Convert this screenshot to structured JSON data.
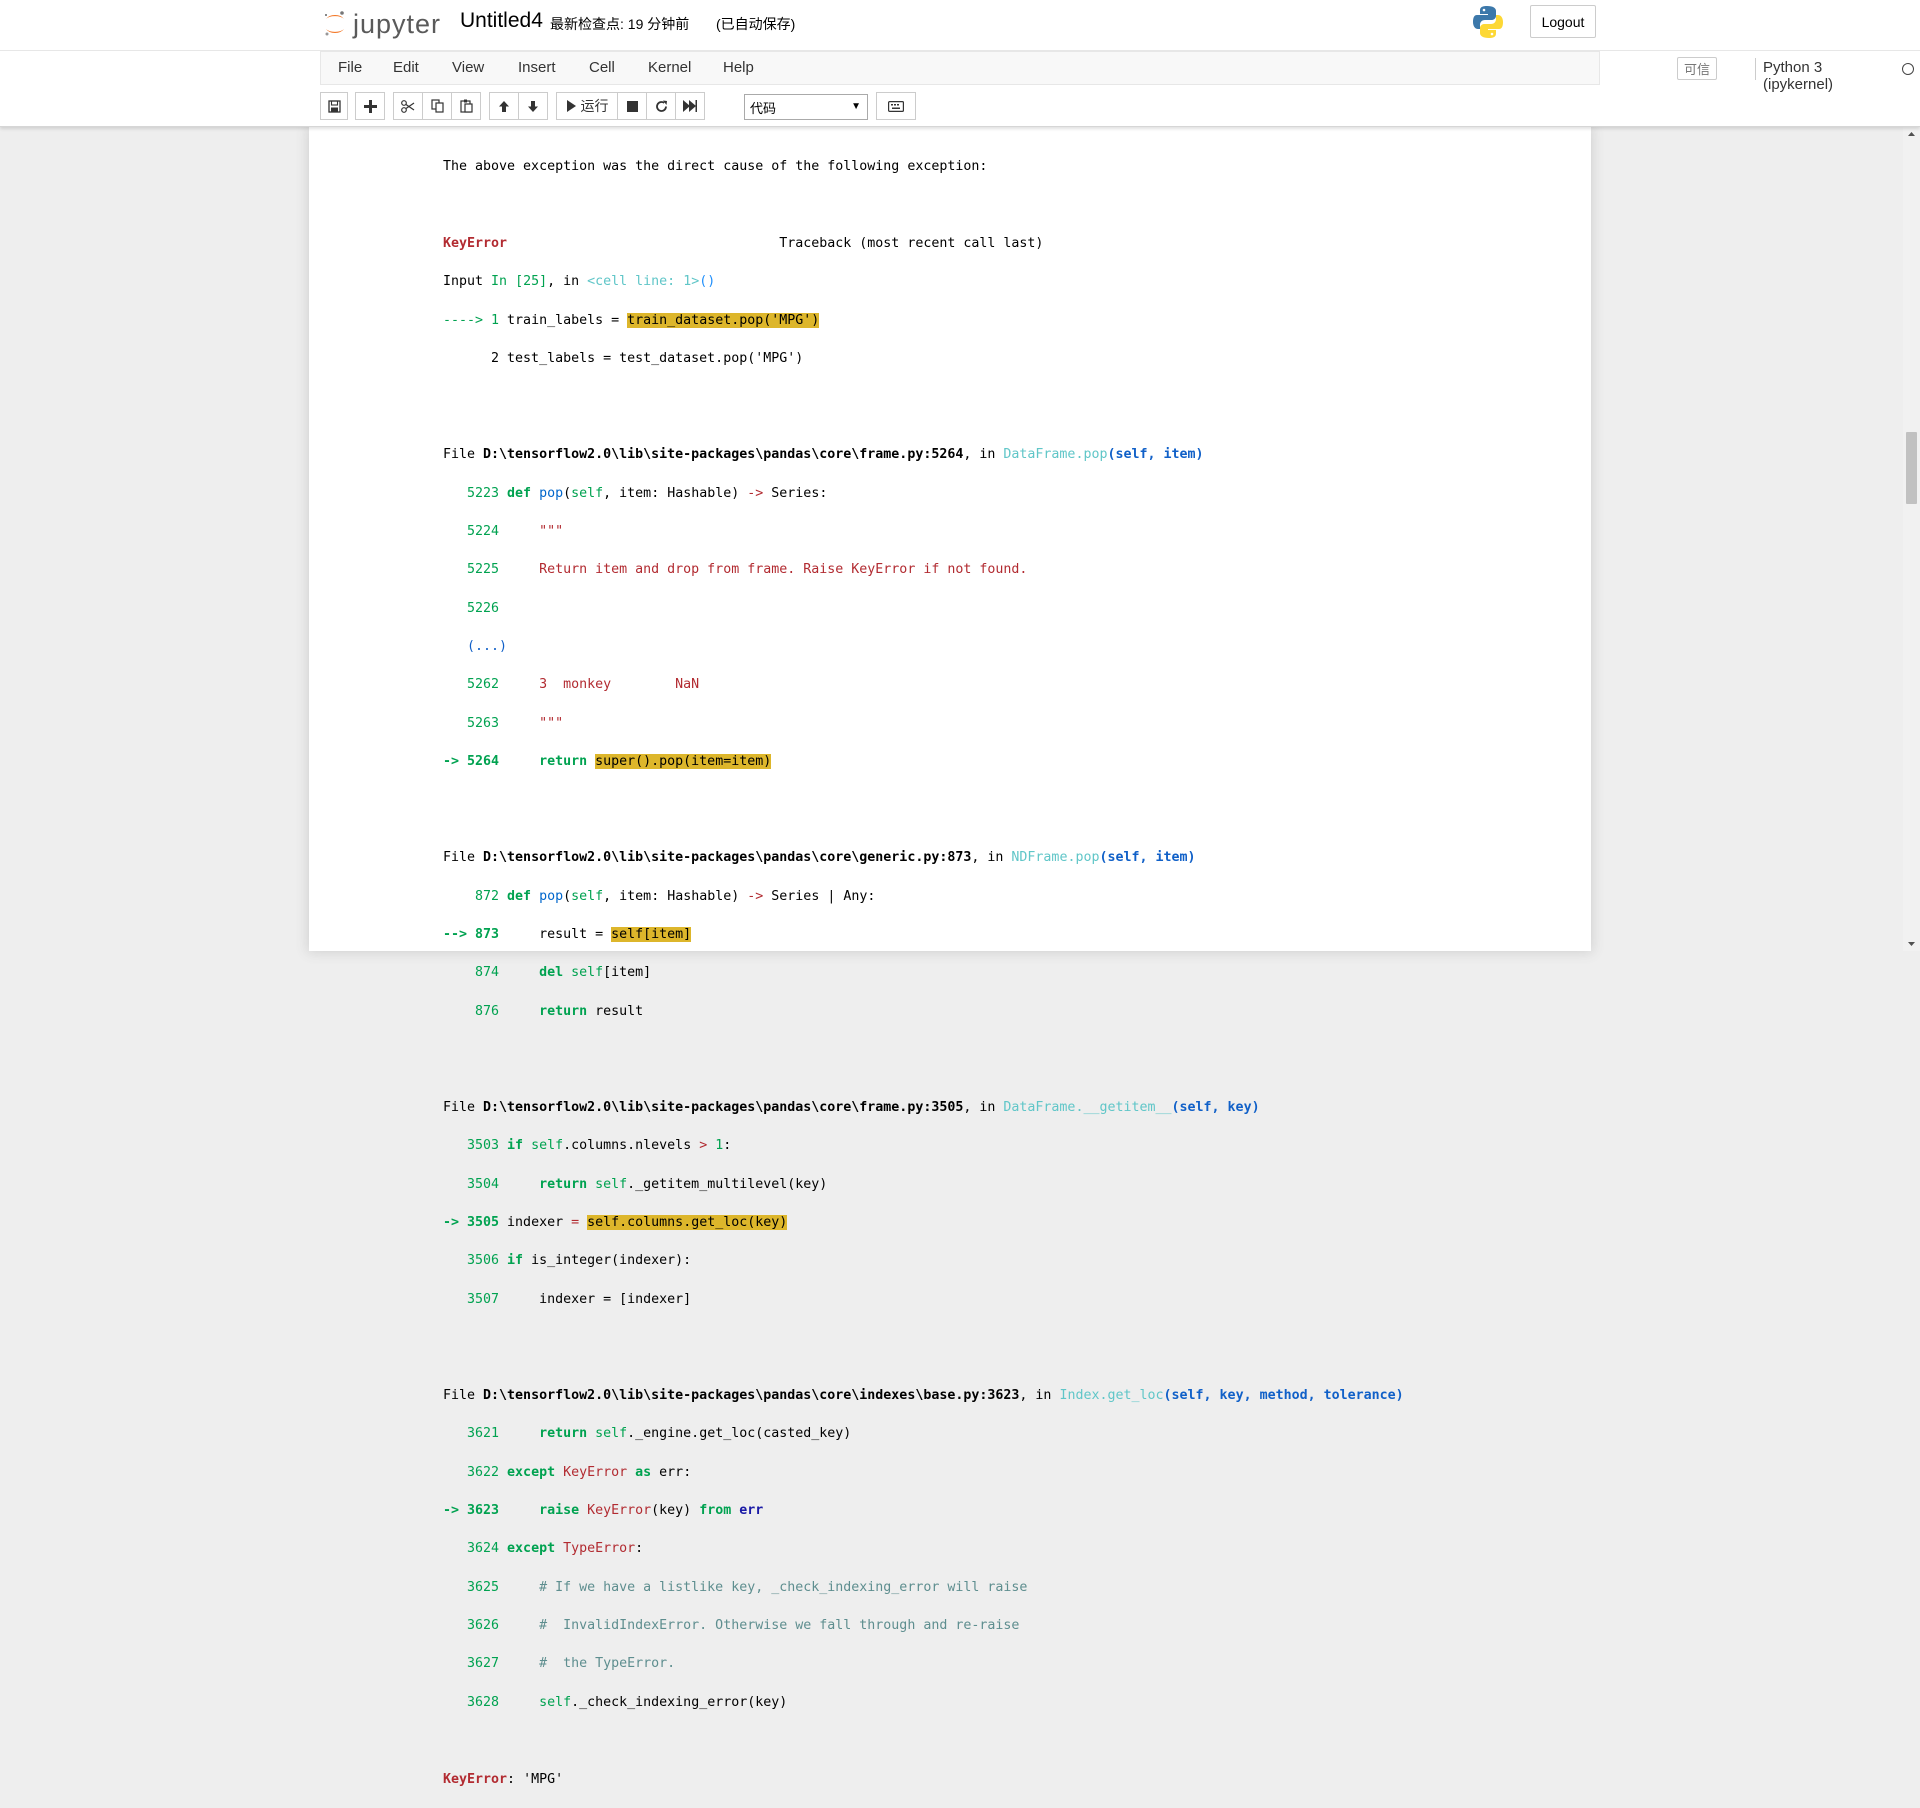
{
  "header": {
    "logo_text": "jupyter",
    "notebook_title": "Untitled4",
    "checkpoint": "最新检查点: 19 分钟前",
    "autosave": "(已自动保存)",
    "logout_label": "Logout"
  },
  "menubar": {
    "items": [
      "File",
      "Edit",
      "View",
      "Insert",
      "Cell",
      "Kernel",
      "Help"
    ],
    "trusted_label": "可信",
    "kernel_name": "Python 3 (ipykernel)"
  },
  "toolbar": {
    "run_label": "运行",
    "cell_type": "代码",
    "buttons": [
      "save-icon",
      "plus-icon",
      "cut-icon",
      "copy-icon",
      "paste-icon",
      "arrow-up-icon",
      "arrow-down-icon",
      "run-icon",
      "stop-icon",
      "restart-icon",
      "fast-forward-icon",
      "keyboard-icon"
    ]
  },
  "traceback": {
    "direct_cause": "The above exception was the direct cause of the following exception:",
    "err_name": "KeyError",
    "tb_header": "                                  Traceback (most recent call last)",
    "input_prefix": "Input ",
    "input_in": "In [25]",
    "input_mid": ", in ",
    "input_cell": "<cell line: 1>",
    "input_paren": "()",
    "arrow1": "----> 1 ",
    "line1_pre": "train_labels = ",
    "line1_hl": "train_dataset.pop('MPG')",
    "line2": "      2 test_labels = test_dataset.pop('MPG')",
    "file1_prefix": "File ",
    "file1_path": "D:\\tensorflow2.0\\lib\\site-packages\\pandas\\core\\frame.py:5264",
    "file1_in": ", in ",
    "file1_func": "DataFrame.pop",
    "file1_args": "(self, item)",
    "f1_l5223_no": "   5223 ",
    "f1_l5223_def": "def ",
    "f1_l5223_name": "pop",
    "f1_l5223_rest1": "(",
    "f1_l5223_self": "self",
    "f1_l5223_rest2": ", item: Hashable) ",
    "f1_l5223_arrow": "->",
    "f1_l5223_rest3": " Series:",
    "f1_l5224_no": "   5224 ",
    "f1_l5224_code": "    \"\"\"",
    "f1_l5225_no": "   5225 ",
    "f1_l5225_code": "    Return item and drop from frame. Raise KeyError if not found.",
    "f1_l5226_no": "   5226 ",
    "f1_ellipsis": "   (...)",
    "f1_l5262_no": "   5262 ",
    "f1_l5262_code": "    3  monkey        NaN",
    "f1_l5263_no": "   5263 ",
    "f1_l5263_code": "    \"\"\"",
    "f1_arrow": "-> 5264 ",
    "f1_l5264_ret": "    return ",
    "f1_l5264_hl": "super().pop(item=item)",
    "file2_path": "D:\\tensorflow2.0\\lib\\site-packages\\pandas\\core\\generic.py:873",
    "file2_func": "NDFrame.pop",
    "file2_args": "(self, item)",
    "f2_l872_no": "    872 ",
    "f2_l872_rest2": ", item: Hashable) ",
    "f2_l872_rest3": " Series | Any:",
    "f2_arrow": "--> 873 ",
    "f2_l873_pre": "    result = ",
    "f2_l873_hl": "self[item]",
    "f2_l874_no": "    874 ",
    "f2_l874_del": "    del ",
    "f2_l874_rest": "[item]",
    "f2_l876_no": "    876 ",
    "f2_l876_ret": "    return ",
    "f2_l876_rest": "result",
    "file3_path": "D:\\tensorflow2.0\\lib\\site-packages\\pandas\\core\\frame.py:3505",
    "file3_func": "DataFrame.__getitem__",
    "file3_args": "(self, key)",
    "f3_l3503_no": "   3503 ",
    "f3_l3503_if": "if ",
    "f3_l3503_rest": ".columns.nlevels ",
    "f3_l3503_gt": ">",
    "f3_l3503_one": " 1",
    "f3_l3503_colon": ":",
    "f3_l3504_no": "   3504 ",
    "f3_l3504_ret": "    return ",
    "f3_l3504_rest": "._getitem_multilevel(key)",
    "f3_arrow": "-> 3505 ",
    "f3_l3505_pre": "indexer ",
    "f3_l3505_eq": "=",
    "f3_l3505_sp": " ",
    "f3_l3505_hl": "self.columns.get_loc(key)",
    "f3_l3506_no": "   3506 ",
    "f3_l3506_rest": "is_integer(indexer):",
    "f3_l3507_no": "   3507 ",
    "f3_l3507_code": "    indexer = [indexer]",
    "file4_path": "D:\\tensorflow2.0\\lib\\site-packages\\pandas\\core\\indexes\\base.py:3623",
    "file4_func": "Index.get_loc",
    "file4_args": "(self, key, method, tolerance)",
    "f4_l3621_no": "   3621 ",
    "f4_l3621_rest": "._engine.get_loc(casted_key)",
    "f4_l3622_no": "   3622 ",
    "f4_l3622_exc": "except ",
    "f4_l3622_as": " as ",
    "f4_l3622_rest": "err:",
    "f4_arrow": "-> 3623 ",
    "f4_l3623_raise": "    raise ",
    "f4_l3623_mid": "(key) ",
    "f4_l3623_from": "from ",
    "f4_l3623_err": "err",
    "f4_l3624_no": "   3624 ",
    "f4_l3624_type": "TypeError",
    "f4_l3625_no": "   3625 ",
    "f4_l3625_code": "    # If we have a listlike key, _check_indexing_error will raise",
    "f4_l3626_no": "   3626 ",
    "f4_l3626_code": "    #  InvalidIndexError. Otherwise we fall through and re-raise",
    "f4_l3627_no": "   3627 ",
    "f4_l3627_code": "    #  the TypeError.",
    "f4_l3628_no": "   3628 ",
    "f4_l3628_rest": "._check_indexing_error(key)",
    "final_sep": ": ",
    "final_msg": "'MPG'",
    "self_kw": "self",
    "indent4": "    "
  }
}
